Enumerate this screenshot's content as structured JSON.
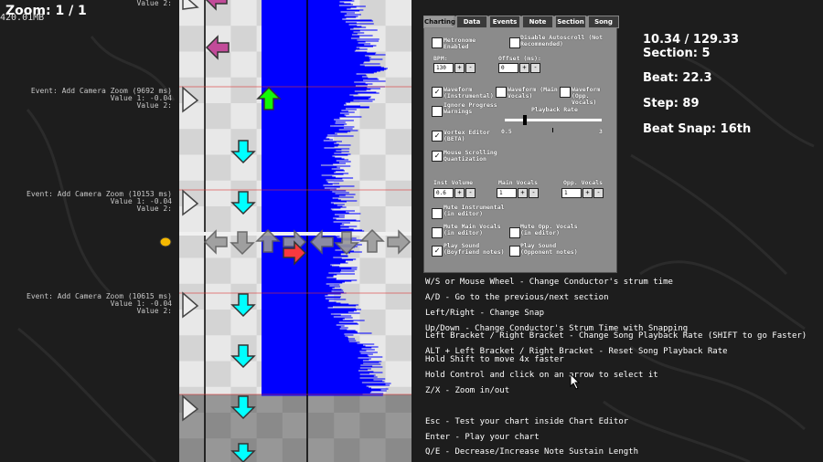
{
  "editor": {
    "zoom_label": "Zoom: 1 / 1",
    "memory_label": "420.01MB"
  },
  "events": [
    {
      "line1": "",
      "line2": "",
      "line3": "Value 2:"
    },
    {
      "line1": "Event: Add Camera Zoom (9692 ms)",
      "line2": "Value 1: -0.04",
      "line3": "Value 2:"
    },
    {
      "line1": "Event: Add Camera Zoom (10153 ms)",
      "line2": "Value 1: -0.04",
      "line3": "Value 2:"
    },
    {
      "line1": "Event: Add Camera Zoom (10615 ms)",
      "line2": "Value 1: -0.04",
      "line3": "Value 2:"
    }
  ],
  "status": {
    "time": "10.34 / 129.33",
    "section": "Section: 5",
    "beat": "Beat: 22.3",
    "step": "Step: 89",
    "beat_snap": "Beat Snap: 16th"
  },
  "tabs": [
    "Charting",
    "Data",
    "Events",
    "Note",
    "Section",
    "Song"
  ],
  "charting": {
    "metronome": "Metronome Enabled",
    "disable_autoscroll": "Disable Autoscroll (Not Recommended)",
    "bpm_label": "BPM:",
    "bpm_value": "130",
    "offset_label": "Offset (ms):",
    "offset_value": "0",
    "waveform_inst": "Waveform (Instrumental)",
    "waveform_main": "Waveform (Main Vocals)",
    "waveform_opp": "Waveform (Opp. Vocals)",
    "ignore_progress": "Ignore Progress Warnings",
    "playback_rate": "Playback Rate",
    "rate_min": "0.5",
    "rate_max": "3",
    "vortex": "Vortex Editor (BETA)",
    "mouse_scroll": "Mouse Scrolling Quantization",
    "inst_volume_label": "Inst Volume",
    "inst_volume_value": "0.6",
    "main_vocals_label": "Main Vocals",
    "main_vocals_value": "1",
    "opp_vocals_label": "Opp. Vocals",
    "opp_vocals_value": "1",
    "mute_inst": "Mute Instrumental (in editor)",
    "mute_main": "Mute Main Vocals (in editor)",
    "mute_opp": "Mute Opp. Vocals (in editor)",
    "play_sound_bf": "Play Sound (Boyfriend notes)",
    "play_sound_opp": "Play Sound (Opponent notes)",
    "plus": "+",
    "minus": "-",
    "checkmark": "✓"
  },
  "help": [
    "W/S or Mouse Wheel - Change Conductor's strum time",
    "A/D - Go to the previous/next section",
    "Left/Right - Change Snap",
    "Up/Down - Change Conductor's Strum Time with Snapping",
    "Left Bracket / Right Bracket - Change Song Playback Rate (SHIFT to go Faster)",
    "ALT + Left Bracket / Right Bracket - Reset Song Playback Rate",
    "Hold Shift to move 4x faster",
    "Hold Control and click on an arrow to select it",
    "Z/X - Zoom in/out",
    "Esc - Test your chart inside Chart Editor",
    "Enter - Play your chart",
    "Q/E - Decrease/Increase Note Sustain Length"
  ],
  "colors": {
    "waveform": "#0000ff",
    "note_left": "#c24b99",
    "note_down": "#00ffff",
    "note_up": "#12fa05",
    "note_right": "#f9393f"
  }
}
